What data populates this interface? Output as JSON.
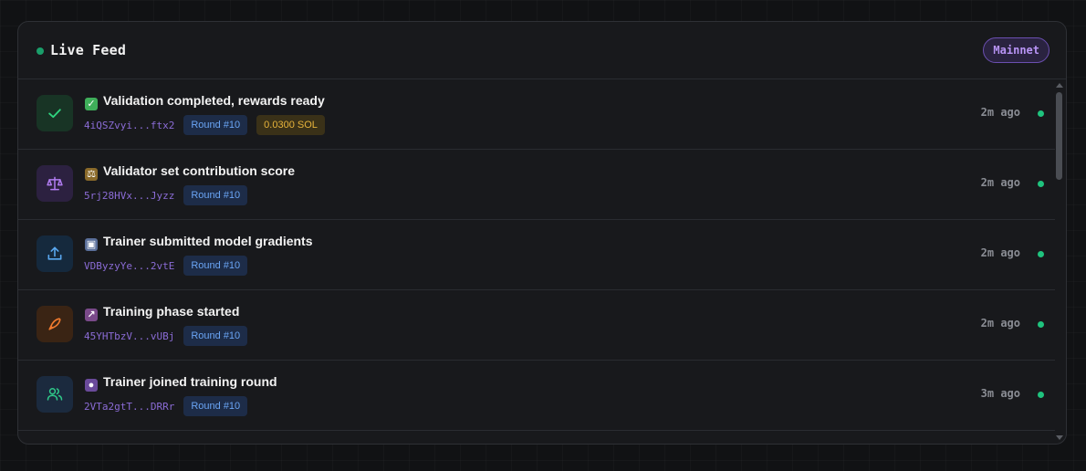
{
  "header": {
    "title": "Live Feed",
    "network": "Mainnet"
  },
  "colors": {
    "live_dot": "#1a9e6a",
    "status_dot": "#1fc37e",
    "accent_purple": "#b894f5",
    "round_tag": "#6aa5f5",
    "sol_tag": "#e6b33a"
  },
  "events": [
    {
      "icon": "check-icon",
      "emoji": "check-mark-button-emoji",
      "title": "Validation completed, rewards ready",
      "address": "4iQSZvyi...ftx2",
      "round": "Round #10",
      "reward": "0.0300 SOL",
      "time": "2m ago"
    },
    {
      "icon": "scale-icon",
      "emoji": "balance-scale-emoji",
      "title": "Validator set contribution score",
      "address": "5rj28HVx...Jyzz",
      "round": "Round #10",
      "time": "2m ago"
    },
    {
      "icon": "upload-icon",
      "emoji": "outbox-emoji",
      "title": "Trainer submitted model gradients",
      "address": "VDByzyYe...2vtE",
      "round": "Round #10",
      "time": "2m ago"
    },
    {
      "icon": "rocket-icon",
      "emoji": "rocket-emoji",
      "title": "Training phase started",
      "address": "45YHTbzV...vUBj",
      "round": "Round #10",
      "time": "2m ago"
    },
    {
      "icon": "users-icon",
      "emoji": "person-silhouette-emoji",
      "title": "Trainer joined training round",
      "address": "2VTa2gtT...DRRr",
      "round": "Round #10",
      "time": "3m ago"
    }
  ]
}
